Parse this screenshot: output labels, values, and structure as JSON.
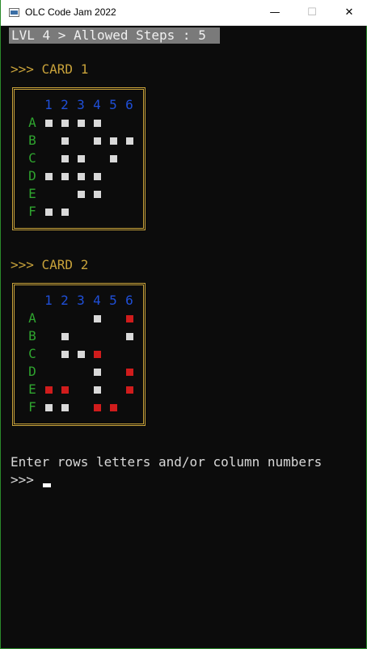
{
  "window": {
    "title": "OLC Code Jam 2022",
    "minimize_glyph": "—",
    "maximize_glyph": "☐",
    "close_glyph": "✕"
  },
  "status": {
    "level_text": "LVL 4 > Allowed Steps : 5"
  },
  "cards": [
    {
      "title": ">>> CARD 1",
      "columns": [
        "1",
        "2",
        "3",
        "4",
        "5",
        "6"
      ],
      "rows": [
        "A",
        "B",
        "C",
        "D",
        "E",
        "F"
      ],
      "grid": [
        [
          "W",
          "W",
          "W",
          "W",
          "",
          ""
        ],
        [
          "",
          "W",
          "",
          "W",
          "W",
          "W"
        ],
        [
          "",
          "W",
          "W",
          "",
          "W",
          ""
        ],
        [
          "W",
          "W",
          "W",
          "W",
          "",
          ""
        ],
        [
          "",
          "",
          "W",
          "W",
          "",
          ""
        ],
        [
          "W",
          "W",
          "",
          "",
          "",
          ""
        ]
      ]
    },
    {
      "title": ">>> CARD 2",
      "columns": [
        "1",
        "2",
        "3",
        "4",
        "5",
        "6"
      ],
      "rows": [
        "A",
        "B",
        "C",
        "D",
        "E",
        "F"
      ],
      "grid": [
        [
          "",
          "",
          "",
          "W",
          "",
          "R"
        ],
        [
          "",
          "W",
          "",
          "",
          "",
          "W"
        ],
        [
          "",
          "W",
          "W",
          "R",
          "",
          ""
        ],
        [
          "",
          "",
          "",
          "W",
          "",
          "R"
        ],
        [
          "R",
          "R",
          "",
          "W",
          "",
          "R"
        ],
        [
          "W",
          "W",
          "",
          "R",
          "R",
          ""
        ]
      ]
    }
  ],
  "prompt": {
    "instruction": "Enter rows letters and/or column numbers",
    "marker": ">>>"
  },
  "colors": {
    "background": "#0c0c0c",
    "gold": "#c8a23a",
    "column_blue": "#1f4fd8",
    "row_green": "#2fa52f",
    "cell_white": "#d9d9d9",
    "cell_red": "#d01c1c"
  }
}
